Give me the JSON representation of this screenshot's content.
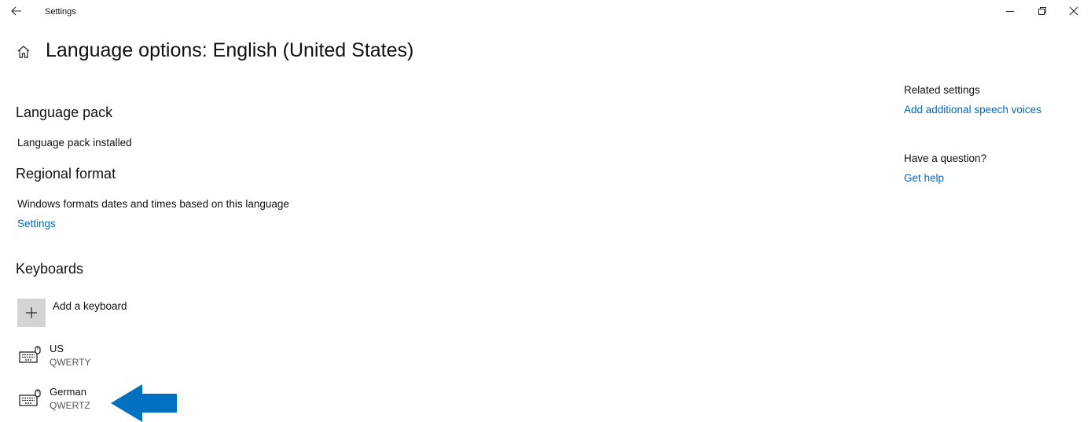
{
  "window": {
    "title": "Settings",
    "back_icon": "arrow-left-icon",
    "minimize_icon": "minimize-icon",
    "restore_icon": "restore-icon",
    "close_icon": "close-icon"
  },
  "page": {
    "title": "Language options: English (United States)",
    "home_icon": "home-icon"
  },
  "language_pack": {
    "heading": "Language pack",
    "status": "Language pack installed"
  },
  "regional_format": {
    "heading": "Regional format",
    "description": "Windows formats dates and times based on this language",
    "settings_link": "Settings"
  },
  "keyboards": {
    "heading": "Keyboards",
    "add_label": "Add a keyboard",
    "items": [
      {
        "name": "US",
        "layout": "QWERTY",
        "icon": "keyboard-icon"
      },
      {
        "name": "German",
        "layout": "QWERTZ",
        "icon": "keyboard-icon"
      }
    ]
  },
  "related": {
    "heading": "Related settings",
    "link": "Add additional speech voices"
  },
  "question": {
    "heading": "Have a question?",
    "link": "Get help"
  },
  "colors": {
    "link": "#0067c0",
    "annotation_arrow": "#0070c0",
    "add_button_bg": "#d4d4d4"
  }
}
